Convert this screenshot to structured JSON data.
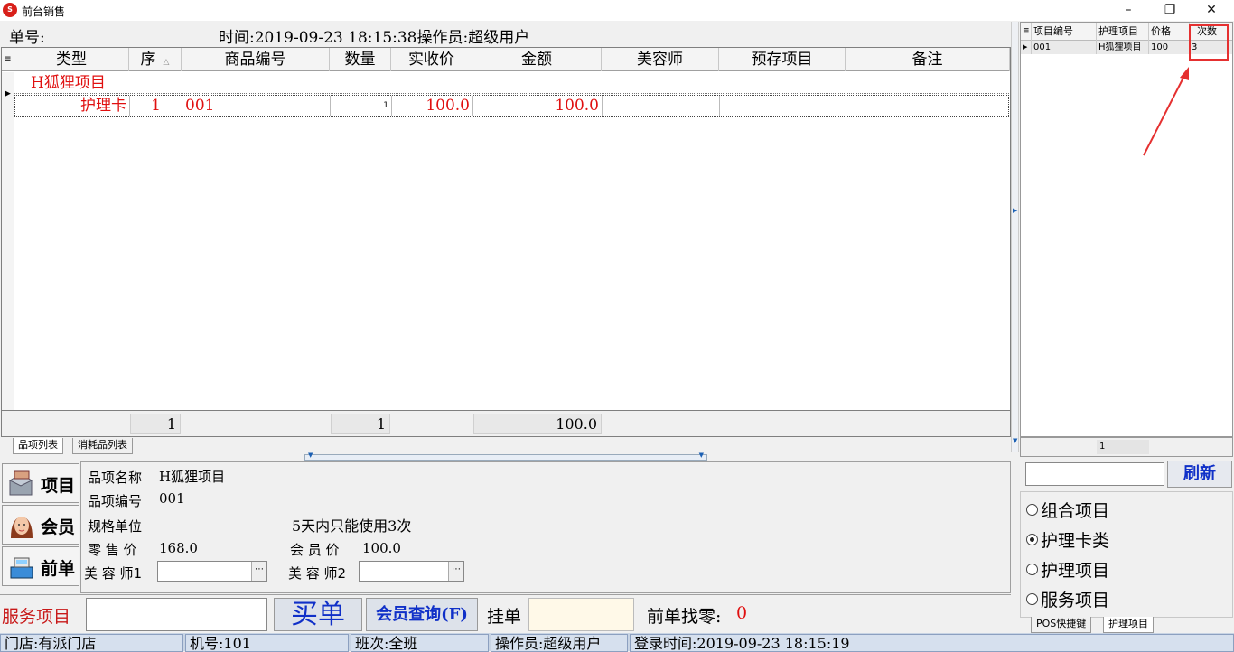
{
  "window": {
    "title": "前台销售",
    "controls": [
      "minimize-icon",
      "restore-icon",
      "close-icon"
    ]
  },
  "header": {
    "order_no_label": "单号:",
    "time_text": "时间:2019-09-23 18:15:38操作员:超级用户"
  },
  "grid": {
    "columns": [
      "类型",
      "序",
      "商品编号",
      "数量",
      "实收价",
      "金额",
      "美容师",
      "预存项目",
      "备注"
    ],
    "group_label": "H狐狸项目",
    "row": {
      "type": "护理卡",
      "seq": "1",
      "code": "001",
      "qty": "1",
      "price": "100.0",
      "amount": "100.0",
      "beautician": "",
      "prepaid": "",
      "remark": ""
    },
    "totals": {
      "seq": "1",
      "qty": "1",
      "amount": "100.0"
    }
  },
  "tabs": [
    "品项列表",
    "消耗品列表"
  ],
  "side_buttons": {
    "item": "项目",
    "member": "会员",
    "prev": "前单"
  },
  "detail": {
    "name_label": "品项名称",
    "name_value": "H狐狸项目",
    "code_label": "品项编号",
    "code_value": "001",
    "unit_label": "规格单位",
    "rule_text": "5天内只能使用3次",
    "retail_label": "零 售 价",
    "retail_value": "168.0",
    "member_label": "会 员 价",
    "member_value": "100.0",
    "beautician1_label": "美 容 师1",
    "beautician2_label": "美 容 师2"
  },
  "bottom": {
    "service_label": "服务项目",
    "buy_button": "买单",
    "member_query_button": "会员查询(F)",
    "hang_label": "挂单",
    "change_label": "前单找零:",
    "change_value": "0"
  },
  "status": {
    "store": "门店:有派门店",
    "machine": "机号:101",
    "shift": "班次:全班",
    "operator": "操作员:超级用户",
    "login": "登录时间:2019-09-23 18:15:19"
  },
  "right_grid": {
    "columns": [
      "项目编号",
      "护理项目",
      "价格",
      "次数"
    ],
    "row": {
      "code": "001",
      "name": "H狐狸项目",
      "price": "100",
      "count": "3"
    },
    "footer_count": "1"
  },
  "refresh_button": "刷新",
  "categories": [
    {
      "label": "组合项目",
      "selected": false
    },
    {
      "label": "护理卡类",
      "selected": true
    },
    {
      "label": "护理项目",
      "selected": false
    },
    {
      "label": "服务项目",
      "selected": false
    }
  ],
  "right_tabs": [
    "POS快捷键",
    "护理项目"
  ],
  "colors": {
    "accent_red": "#e01010",
    "annotation_red": "#e53030",
    "status_bar": "#c8d4e4"
  }
}
